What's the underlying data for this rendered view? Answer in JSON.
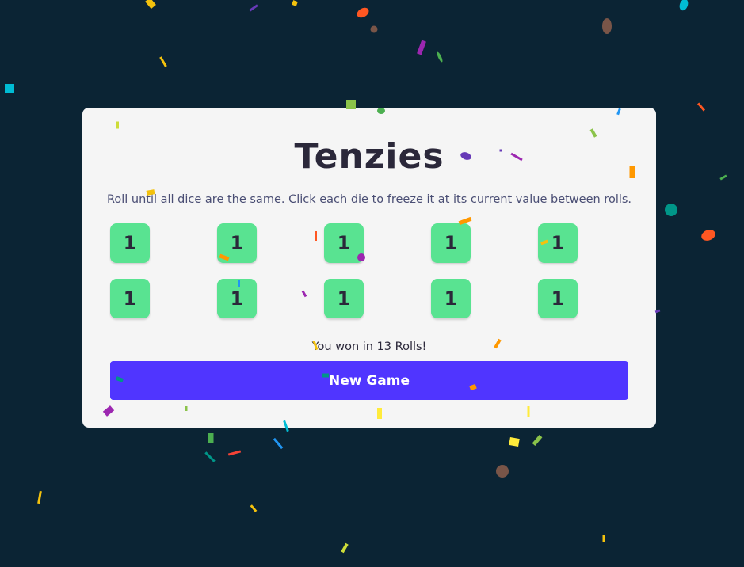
{
  "game": {
    "title": "Tenzies",
    "instructions": "Roll until all dice are the same. Click each die to freeze it at its current value between rolls.",
    "dice": [
      "1",
      "1",
      "1",
      "1",
      "1",
      "1",
      "1",
      "1",
      "1",
      "1"
    ],
    "status": "You won in 13 Rolls!",
    "new_game_label": "New Game"
  },
  "colors": {
    "background": "#0b2434",
    "card": "#f5f5f5",
    "die_held": "#59e391",
    "button": "#5035ff",
    "text": "#2b283a"
  },
  "confetti": [
    "#f4c20d",
    "#ff5722",
    "#9c27b0",
    "#4caf50",
    "#00bcd4",
    "#795548",
    "#ff9800",
    "#8bc34a",
    "#673ab7",
    "#f44336",
    "#009688",
    "#ffeb3b",
    "#2196f3",
    "#cddc39"
  ]
}
